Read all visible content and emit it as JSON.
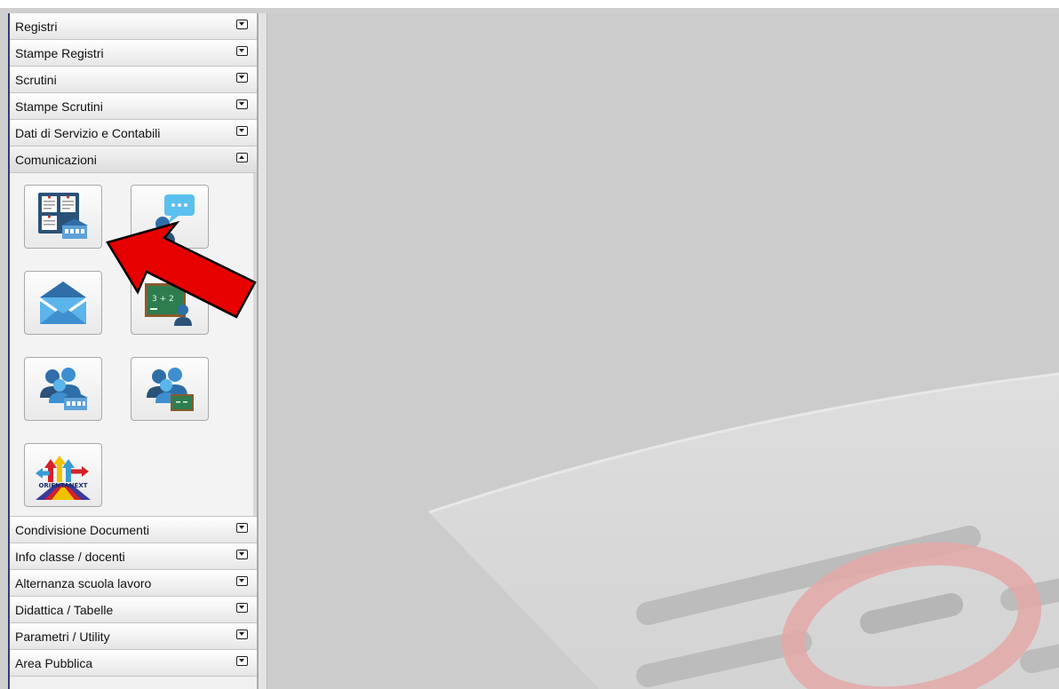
{
  "menu": {
    "sections_before": [
      {
        "label": "Registri"
      },
      {
        "label": "Stampe Registri"
      },
      {
        "label": "Scrutini"
      },
      {
        "label": "Stampe Scrutini"
      },
      {
        "label": "Dati di Servizio e Contabili"
      }
    ],
    "open_section": {
      "label": "Comunicazioni"
    },
    "tile_labels": {
      "orientanext": "ORIENTANEXT"
    },
    "sections_after": [
      {
        "label": "Condivisione Documenti"
      },
      {
        "label": "Info classe / docenti"
      },
      {
        "label": "Alternanza scuola lavoro"
      },
      {
        "label": "Didattica / Tabelle"
      },
      {
        "label": "Parametri / Utility"
      },
      {
        "label": "Area Pubblica"
      }
    ]
  },
  "icons": {
    "bacheca": "bulletin-board-school-icon",
    "chat": "chat-user-icon",
    "mail": "envelope-icon",
    "lesson": "blackboard-teacher-icon",
    "group_school": "group-school-icon",
    "group_board": "group-blackboard-icon",
    "orienta": "orientanext-icon",
    "collapse": "chevron-down-icon",
    "expand": "chevron-up-icon"
  },
  "colors": {
    "accent_blue": "#2f6ea8",
    "arrow_red": "#e60000",
    "sidebar_border": "#2b3f6e"
  }
}
